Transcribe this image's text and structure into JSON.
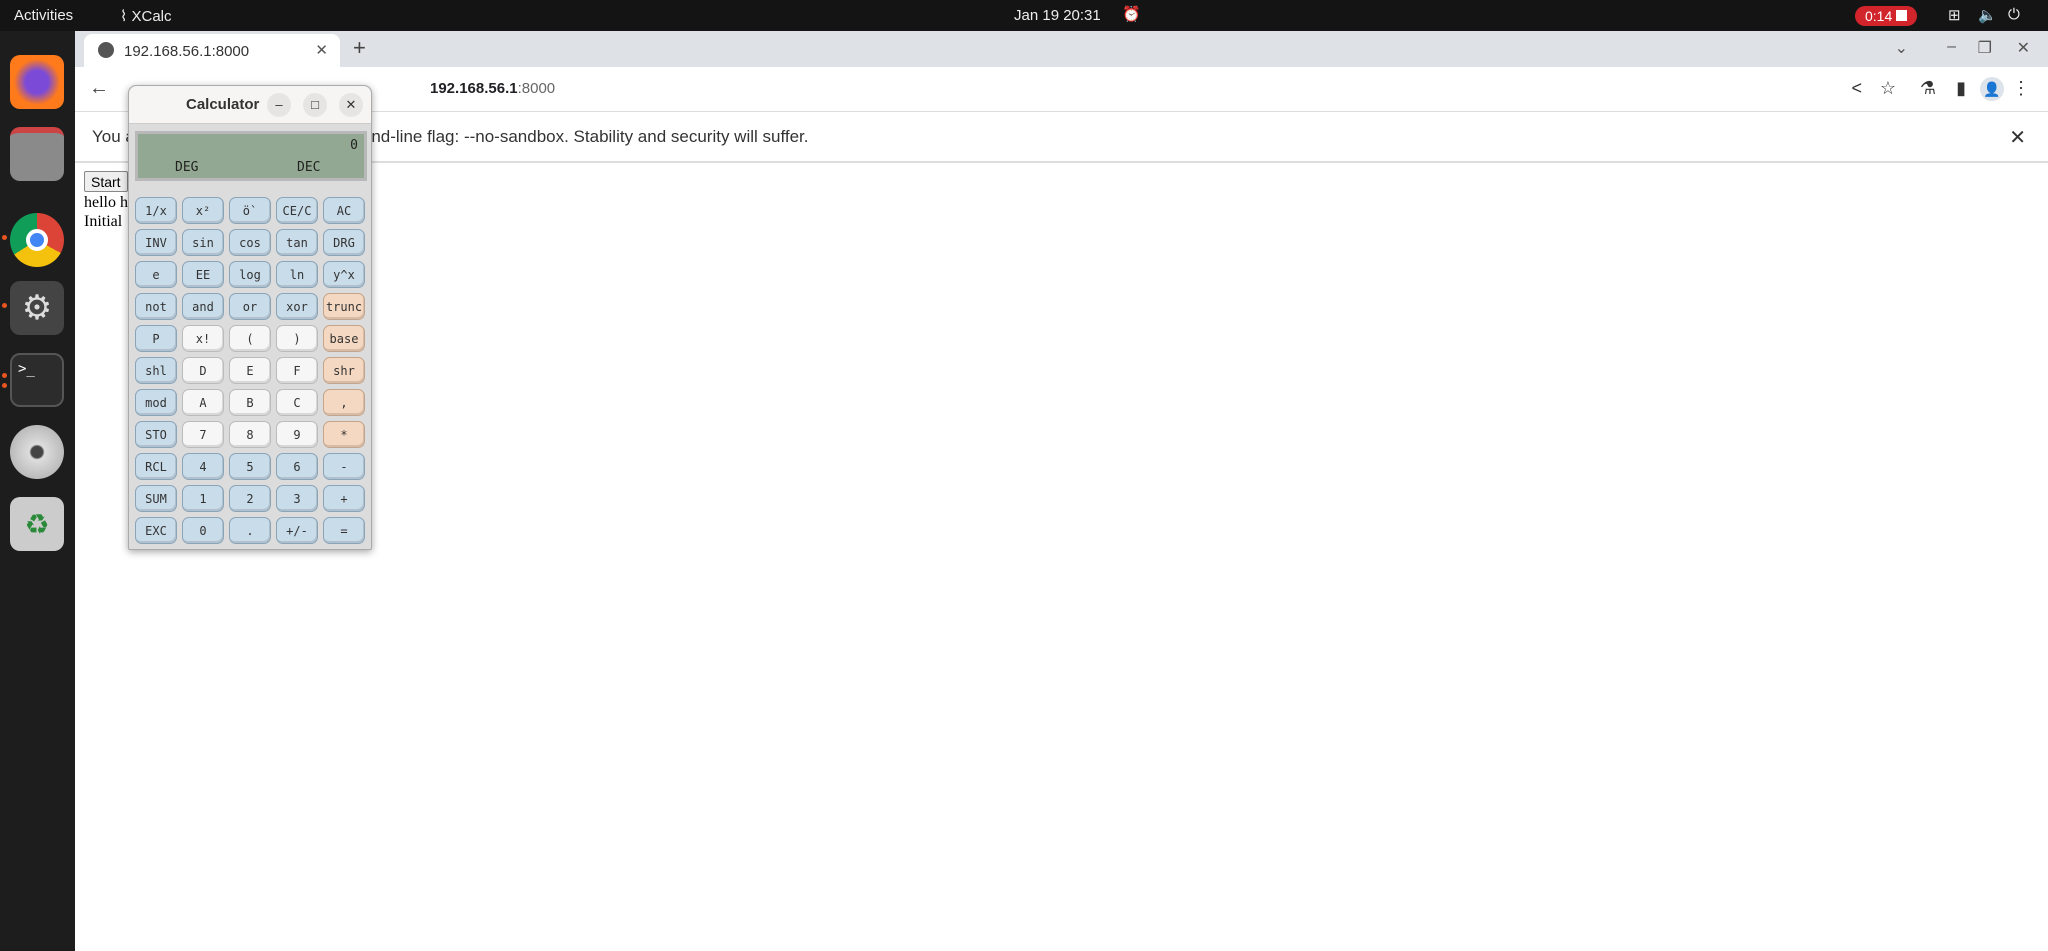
{
  "topbar": {
    "activities": "Activities",
    "app_name": "XCalc",
    "clock": "Jan 19  20:31",
    "recording_time": "0:14"
  },
  "dock": {
    "items": [
      "firefox",
      "files",
      "chrome",
      "settings",
      "terminal",
      "dvd",
      "trash"
    ]
  },
  "browser": {
    "tab_title": "192.168.56.1:8000",
    "url_host": "192.168.56.1",
    "url_port": ":8000",
    "infobar_visible_start": "You a",
    "infobar_text": "and-line flag: --no-sandbox. Stability and security will suffer."
  },
  "page": {
    "start_button": "Start",
    "line1": "hello h",
    "line2": "Initial"
  },
  "calculator": {
    "title": "Calculator",
    "display_value": "0",
    "angle_mode": "DEG",
    "base_mode": "DEC",
    "colors": {
      "blue": "#c9dcea",
      "white": "#f6f6f6",
      "orange": "#f4d8c2",
      "display": "#93a893"
    },
    "keys": [
      {
        "label": "1/x",
        "c": "b"
      },
      {
        "label": "x²",
        "c": "b"
      },
      {
        "label": "ö`",
        "c": "b"
      },
      {
        "label": "CE/C",
        "c": "b"
      },
      {
        "label": "AC",
        "c": "b"
      },
      {
        "label": "INV",
        "c": "b"
      },
      {
        "label": "sin",
        "c": "b"
      },
      {
        "label": "cos",
        "c": "b"
      },
      {
        "label": "tan",
        "c": "b"
      },
      {
        "label": "DRG",
        "c": "b"
      },
      {
        "label": "e",
        "c": "b"
      },
      {
        "label": "EE",
        "c": "b"
      },
      {
        "label": "log",
        "c": "b"
      },
      {
        "label": "ln",
        "c": "b"
      },
      {
        "label": "y^x",
        "c": "b"
      },
      {
        "label": "not",
        "c": "b"
      },
      {
        "label": "and",
        "c": "b"
      },
      {
        "label": "or",
        "c": "b"
      },
      {
        "label": "xor",
        "c": "b"
      },
      {
        "label": "trunc",
        "c": "o"
      },
      {
        "label": "P",
        "c": "b"
      },
      {
        "label": "x!",
        "c": "w"
      },
      {
        "label": "(",
        "c": "w"
      },
      {
        "label": ")",
        "c": "w"
      },
      {
        "label": "base",
        "c": "o"
      },
      {
        "label": "shl",
        "c": "b"
      },
      {
        "label": "D",
        "c": "w"
      },
      {
        "label": "E",
        "c": "w"
      },
      {
        "label": "F",
        "c": "w"
      },
      {
        "label": "shr",
        "c": "o"
      },
      {
        "label": "mod",
        "c": "b"
      },
      {
        "label": "A",
        "c": "w"
      },
      {
        "label": "B",
        "c": "w"
      },
      {
        "label": "C",
        "c": "w"
      },
      {
        "label": ",",
        "c": "o"
      },
      {
        "label": "STO",
        "c": "b"
      },
      {
        "label": "7",
        "c": "w"
      },
      {
        "label": "8",
        "c": "w"
      },
      {
        "label": "9",
        "c": "w"
      },
      {
        "label": "*",
        "c": "o"
      },
      {
        "label": "RCL",
        "c": "b"
      },
      {
        "label": "4",
        "c": "b"
      },
      {
        "label": "5",
        "c": "b"
      },
      {
        "label": "6",
        "c": "b"
      },
      {
        "label": "-",
        "c": "b"
      },
      {
        "label": "SUM",
        "c": "b"
      },
      {
        "label": "1",
        "c": "b"
      },
      {
        "label": "2",
        "c": "b"
      },
      {
        "label": "3",
        "c": "b"
      },
      {
        "label": "+",
        "c": "b"
      },
      {
        "label": "EXC",
        "c": "b"
      },
      {
        "label": "0",
        "c": "b"
      },
      {
        "label": ".",
        "c": "b"
      },
      {
        "label": "+/-",
        "c": "b"
      },
      {
        "label": "=",
        "c": "b"
      }
    ]
  }
}
